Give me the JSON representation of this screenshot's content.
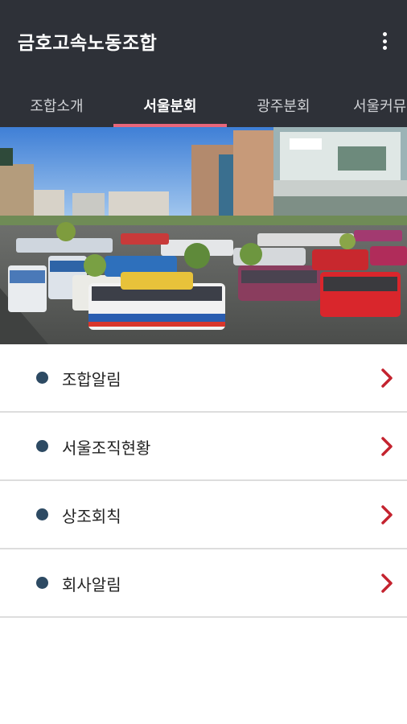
{
  "app_bar": {
    "title": "금호고속노동조합",
    "overflow_icon": "more-vert-icon"
  },
  "tabs": [
    {
      "label": "조합소개",
      "active": false
    },
    {
      "label": "서울분회",
      "active": true
    },
    {
      "label": "광주분회",
      "active": false
    },
    {
      "label": "서울커뮤",
      "active": false
    }
  ],
  "colors": {
    "app_bar_bg": "#2e3138",
    "tab_indicator": "#e8667a",
    "bullet": "#2d4a63",
    "chevron": "#c4232f"
  },
  "menu": {
    "items": [
      {
        "label": "조합알림"
      },
      {
        "label": "서울조직현황"
      },
      {
        "label": "상조회칙"
      },
      {
        "label": "회사알림"
      }
    ]
  }
}
